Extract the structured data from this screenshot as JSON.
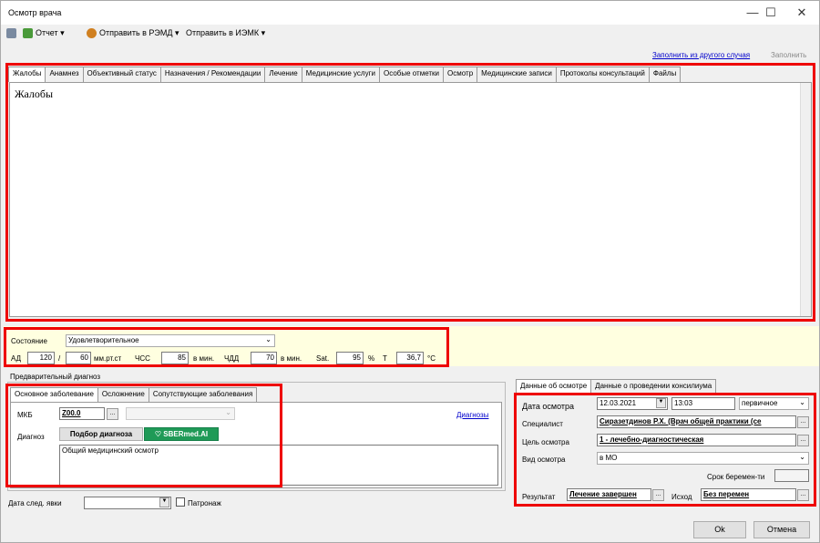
{
  "window": {
    "title": "Осмотр врача",
    "minimize": "—",
    "maximize": "☐",
    "close": "✕"
  },
  "toolbar": {
    "report": "Отчет ▾",
    "send_remd": "Отправить в РЭМД ▾",
    "send_iemk": "Отправить в ИЭМК ▾"
  },
  "top_links": {
    "fill_other": "Заполнить из другого случая",
    "fill": "Заполнить"
  },
  "tabs": [
    "Жалобы",
    "Анамнез",
    "Объективный статус",
    "Назначения / Рекомендации",
    "Лечение",
    "Медицинские услуги",
    "Особые отметки",
    "Осмотр",
    "Медицинские записи",
    "Протоколы консультаций",
    "Файлы"
  ],
  "complaints_text": "Жалобы",
  "vitals": {
    "state_label": "Состояние",
    "state_value": "Удовлетворительное",
    "ad_label": "АД",
    "ad_sys": "120",
    "slash": "/",
    "ad_dia": "60",
    "ad_unit": "мм.рт.ст",
    "hr_label": "ЧСС",
    "hr_value": "85",
    "hr_unit": "в мин.",
    "rr_label": "ЧДД",
    "rr_value": "70",
    "rr_unit": "в мин.",
    "sat_label": "Sat.",
    "sat_value": "95",
    "sat_unit": "%",
    "t_label": "T",
    "t_value": "36,7",
    "t_unit": "°C"
  },
  "diagnosis": {
    "group_title": "Предварительный диагноз",
    "tabs": [
      "Основное заболевание",
      "Осложнение",
      "Сопутствующие заболевания"
    ],
    "mkb_label": "МКБ",
    "mkb_value": "Z00.0",
    "diagnoses_link": "Диагнозы",
    "diag_label": "Диагноз",
    "podbor": "Подбор диагноза",
    "sber": "SBERmed.AI",
    "diag_text": "Общий медицинский осмотр"
  },
  "next_visit": {
    "label": "Дата след. явки",
    "patronage": "Патронаж"
  },
  "exam": {
    "tabs": [
      "Данные об осмотре",
      "Данные о проведении консилиума"
    ],
    "date_label": "Дата осмотра",
    "date_value": "12.03.2021",
    "time_value": "13:03",
    "type_value": "первичное",
    "spec_label": "Специалист",
    "spec_value": "Сиразетдинов Р.Х. (Врач общей практики (се",
    "goal_label": "Цель осмотра",
    "goal_value": "1 - лечебно-диагностическая",
    "kind_label": "Вид осмотра",
    "kind_value": "в МО",
    "preg_label": "Срок беремен-ти",
    "result_label": "Результат",
    "result_value": "Лечение завершен",
    "outcome_label": "Исход",
    "outcome_value": "Без перемен"
  },
  "buttons": {
    "ok": "Ok",
    "cancel": "Отмена"
  }
}
